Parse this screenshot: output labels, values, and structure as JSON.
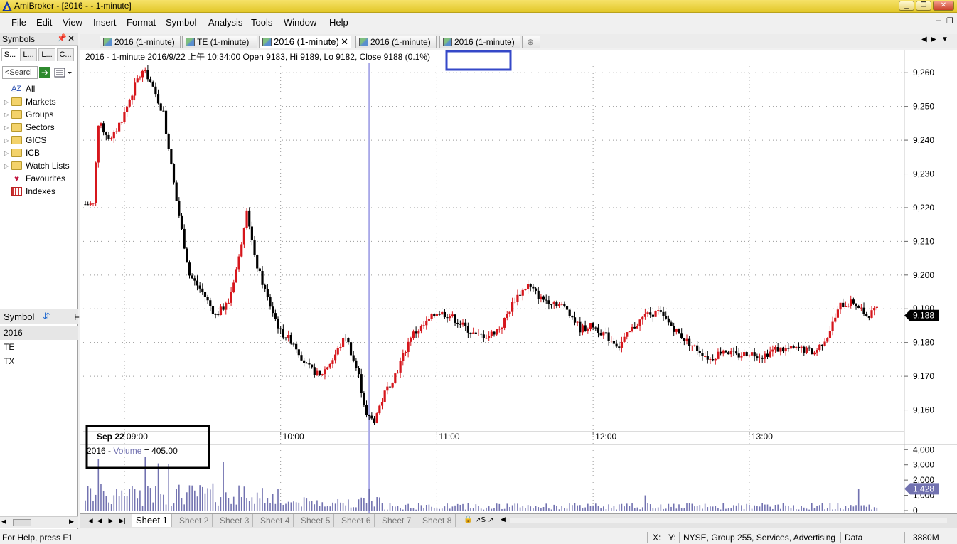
{
  "window": {
    "title": "AmiBroker - [2016 -  - 1-minute]",
    "controls": [
      "_",
      "❐",
      "✕"
    ]
  },
  "menu": [
    "File",
    "Edit",
    "View",
    "Insert",
    "Format",
    "Symbol",
    "Analysis",
    "Tools",
    "Window",
    "Help"
  ],
  "mdi_controls": [
    "–",
    "❐"
  ],
  "symbols_panel": {
    "title": "Symbols",
    "tabs": [
      "S...",
      "L...",
      "L...",
      "C..."
    ],
    "search_placeholder": "<Searcl",
    "tree": [
      {
        "label": "All",
        "icon": "all-icon"
      },
      {
        "label": "Markets",
        "icon": "folder-icon"
      },
      {
        "label": "Groups",
        "icon": "folder-icon"
      },
      {
        "label": "Sectors",
        "icon": "folder-icon"
      },
      {
        "label": "GICS",
        "icon": "folder-icon"
      },
      {
        "label": "ICB",
        "icon": "folder-icon"
      },
      {
        "label": "Watch Lists",
        "icon": "folder-icon"
      },
      {
        "label": "Favourites",
        "icon": "heart-icon"
      },
      {
        "label": "Indexes",
        "icon": "grid-icon"
      }
    ]
  },
  "symbol_list": {
    "header": "Symbol",
    "header_right": "F",
    "rows": [
      "2016",
      "TE",
      "TX"
    ]
  },
  "doc_tabs": [
    {
      "label": "2016 (1-minute)",
      "active": false
    },
    {
      "label": "TE (1-minute)",
      "active": false
    },
    {
      "label": "2016 (1-minute)",
      "active": true
    },
    {
      "label": "2016 (1-minute)",
      "active": false
    },
    {
      "label": "2016 (1-minute)",
      "active": false
    }
  ],
  "doc_tab_close": "✕",
  "chart_data": {
    "type": "candlestick",
    "header_text": "2016 - 1-minute 2016/9/22 上午 10:34:00 Open 9183, Hi 9189, Lo 9182, Close 9188 (0.1%)",
    "price_ticks": [
      "9,260",
      "9,250",
      "9,240",
      "9,230",
      "9,220",
      "9,210",
      "9,200",
      "9,190",
      "9,180",
      "9,170",
      "9,160"
    ],
    "price_ylim": [
      9154,
      9263
    ],
    "last_price_label": "9,188",
    "last_price": 9188,
    "x_date_label": "Sep 22",
    "x_time_labels": [
      "09:00",
      "10:00",
      "11:00",
      "12:00",
      "13:00"
    ],
    "x_range_minutes": [
      525,
      830
    ],
    "volume_label_prefix": "2016 - ",
    "volume_label_name": "Volume",
    "volume_label_value": " = 405.00",
    "volume_ticks": [
      "4,000",
      "3,000",
      "2,000",
      "1,000",
      "0"
    ],
    "volume_ylim": [
      0,
      4200
    ],
    "last_volume_label": "1,428",
    "cursor_minute": 634,
    "close_keypoints": [
      [
        525,
        9221
      ],
      [
        528,
        9221
      ],
      [
        530,
        9245
      ],
      [
        535,
        9240
      ],
      [
        540,
        9248
      ],
      [
        545,
        9258
      ],
      [
        548,
        9261
      ],
      [
        551,
        9255
      ],
      [
        555,
        9248
      ],
      [
        560,
        9222
      ],
      [
        565,
        9200
      ],
      [
        570,
        9195
      ],
      [
        575,
        9188
      ],
      [
        580,
        9192
      ],
      [
        584,
        9205
      ],
      [
        587,
        9220
      ],
      [
        590,
        9205
      ],
      [
        595,
        9193
      ],
      [
        600,
        9183
      ],
      [
        605,
        9180
      ],
      [
        610,
        9173
      ],
      [
        615,
        9170
      ],
      [
        620,
        9175
      ],
      [
        625,
        9182
      ],
      [
        630,
        9170
      ],
      [
        633,
        9158
      ],
      [
        636,
        9157
      ],
      [
        640,
        9165
      ],
      [
        645,
        9172
      ],
      [
        650,
        9182
      ],
      [
        655,
        9185
      ],
      [
        660,
        9189
      ],
      [
        665,
        9188
      ],
      [
        670,
        9185
      ],
      [
        675,
        9182
      ],
      [
        680,
        9182
      ],
      [
        685,
        9185
      ],
      [
        690,
        9193
      ],
      [
        695,
        9197
      ],
      [
        700,
        9193
      ],
      [
        705,
        9192
      ],
      [
        710,
        9190
      ],
      [
        715,
        9184
      ],
      [
        720,
        9185
      ],
      [
        725,
        9182
      ],
      [
        730,
        9179
      ],
      [
        735,
        9184
      ],
      [
        740,
        9188
      ],
      [
        745,
        9189
      ],
      [
        750,
        9185
      ],
      [
        755,
        9181
      ],
      [
        760,
        9178
      ],
      [
        765,
        9175
      ],
      [
        770,
        9178
      ],
      [
        775,
        9176
      ],
      [
        780,
        9177
      ],
      [
        785,
        9176
      ],
      [
        790,
        9178
      ],
      [
        795,
        9178
      ],
      [
        800,
        9178
      ],
      [
        805,
        9177
      ],
      [
        810,
        9182
      ],
      [
        815,
        9191
      ],
      [
        820,
        9192
      ],
      [
        825,
        9188
      ],
      [
        830,
        9190
      ],
      [
        835,
        9190
      ],
      [
        840,
        9190
      ],
      [
        845,
        9186
      ],
      [
        850,
        9188
      ]
    ],
    "volume_spikes": [
      [
        530,
        3400
      ],
      [
        548,
        3500
      ],
      [
        553,
        3100
      ],
      [
        557,
        3050
      ],
      [
        578,
        3200
      ],
      [
        634,
        1450
      ],
      [
        740,
        1000
      ],
      [
        822,
        1428
      ]
    ]
  },
  "sheets": [
    "Sheet 1",
    "Sheet 2",
    "Sheet 3",
    "Sheet 4",
    "Sheet 5",
    "Sheet 6",
    "Sheet 7",
    "Sheet 8"
  ],
  "sheet_nav": [
    "|◀",
    "◀",
    "▶",
    "▶|"
  ],
  "sheet_tools": [
    "🔒",
    "↗S",
    "↗"
  ],
  "status": {
    "help": "For Help, press F1",
    "x_label": "X:",
    "y_label": "Y:",
    "market_info": "NYSE, Group 255, Services, Advertising",
    "data": "Data",
    "memory": "3880M"
  },
  "colors": {
    "up_candle": "#d6161c",
    "down_candle": "#000000",
    "cursor_line": "#a8a8e8",
    "volume_bar": "#7272b0",
    "highlight_box": "#3548c8"
  }
}
